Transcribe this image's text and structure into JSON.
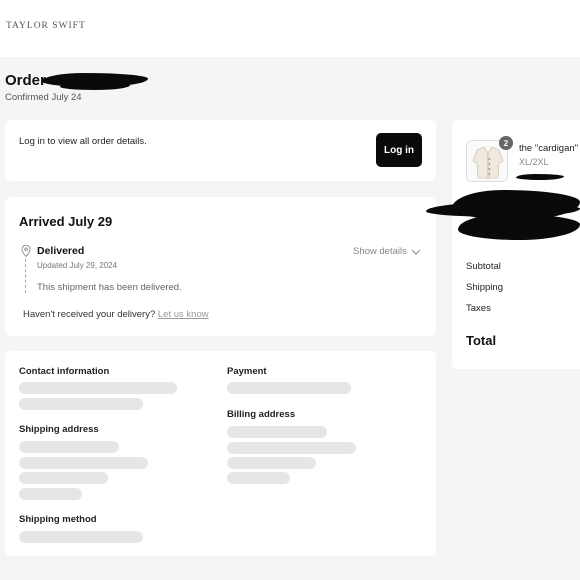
{
  "header": {
    "brand": "TAYLOR SWIFT"
  },
  "order": {
    "title": "Order",
    "confirmed": "Confirmed July 24"
  },
  "login_card": {
    "prompt": "Log in to view all order details.",
    "button_label": "Log in"
  },
  "delivery_card": {
    "title": "Arrived July 29",
    "status": "Delivered",
    "updated": "Updated July 29, 2024",
    "show_details": "Show details",
    "message": "This shipment has been delivered.",
    "not_received": "Haven't received your delivery?",
    "let_us_know": "Let us know"
  },
  "details_card": {
    "contact": "Contact information",
    "payment": "Payment",
    "shipping_address": "Shipping address",
    "billing_address": "Billing address",
    "shipping_method": "Shipping method"
  },
  "summary": {
    "item_name": "the \"cardigan\"",
    "item_variant": "XL/2XL",
    "quantity": "2",
    "subtotal": "Subtotal",
    "shipping": "Shipping",
    "taxes": "Taxes",
    "total": "Total"
  },
  "icons": {
    "pin": "map-pin-icon",
    "chevron": "chevron-down-icon",
    "product": "cardigan-image"
  }
}
